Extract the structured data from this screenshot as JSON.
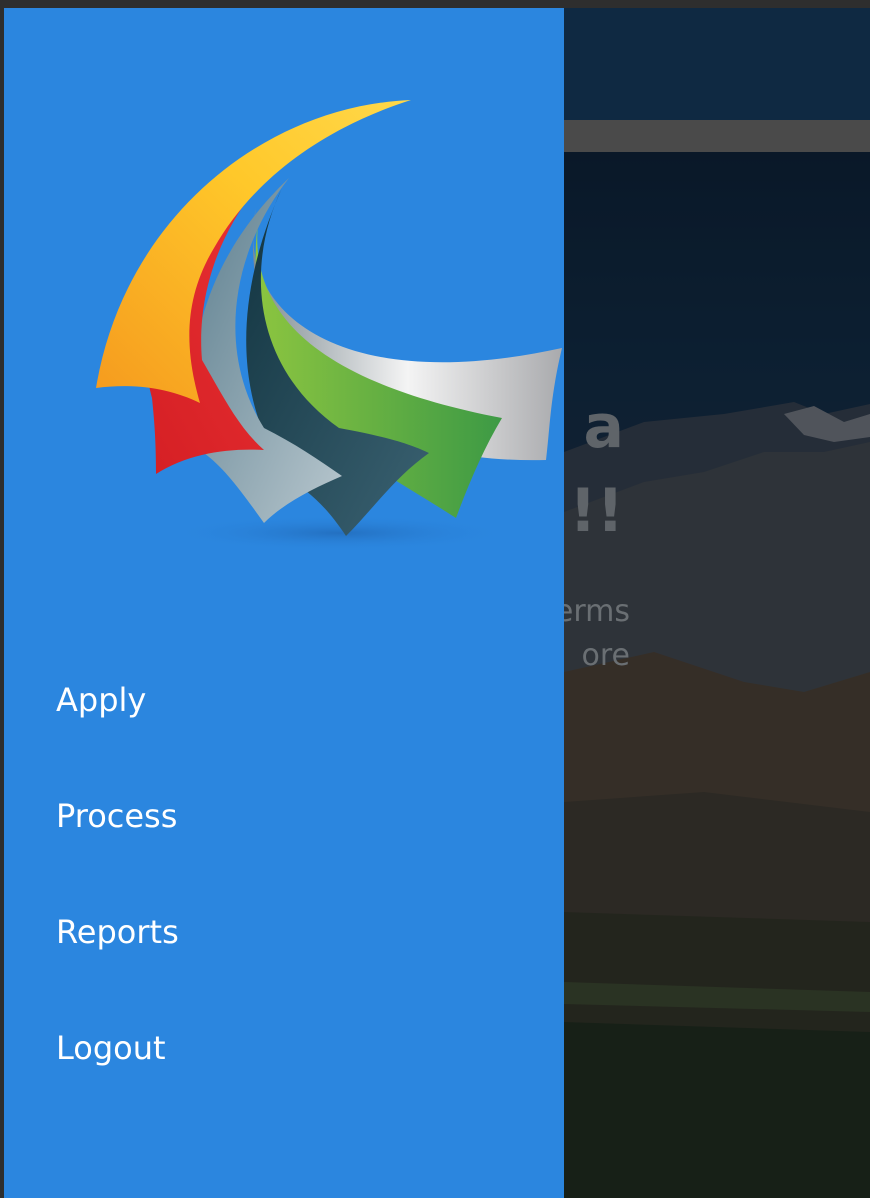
{
  "background": {
    "hero_headline_lines": [
      "t a",
      "e!!!"
    ],
    "hero_sub_lines": [
      "erms",
      "ore"
    ]
  },
  "drawer": {
    "logo_icon": "app-logo",
    "menu": [
      {
        "label": "Apply"
      },
      {
        "label": "Process"
      },
      {
        "label": "Reports"
      },
      {
        "label": "Logout"
      }
    ]
  },
  "colors": {
    "drawer_bg": "#2b86df",
    "header_bg": "#0f2942",
    "menu_text": "#ffffff"
  }
}
